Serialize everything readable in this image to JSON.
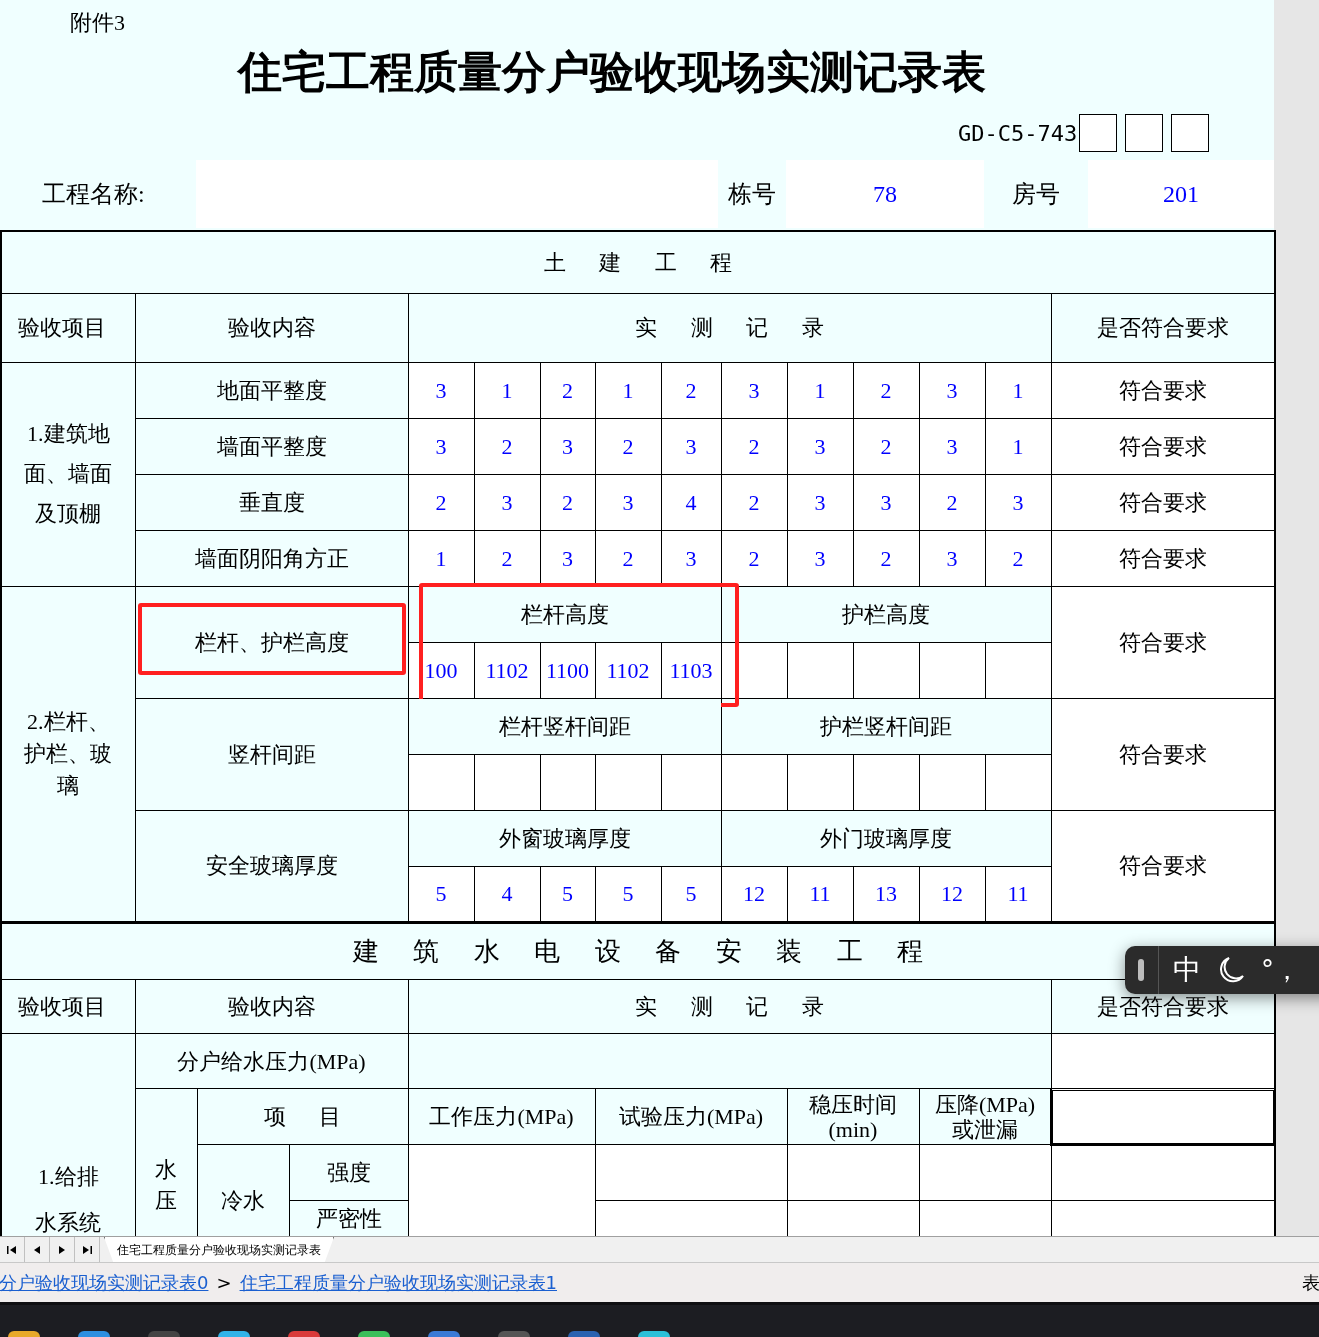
{
  "header": {
    "attachment": "附件3",
    "title": "住宅工程质量分户验收现场实测记录表",
    "code": "GD-C5-743"
  },
  "project": {
    "name_label": "工程名称:",
    "building_label": "栋号",
    "building": "78",
    "room_label": "房号",
    "room": "201"
  },
  "civil": {
    "title": "土 建 工 程",
    "headers": [
      "验收项目",
      "验收内容",
      "实 测 记 录",
      "是否符合要求"
    ],
    "group1": {
      "item": "1.建筑地面、墙面及顶棚",
      "rows": [
        {
          "content": "地面平整度",
          "values": [
            "3",
            "1",
            "2",
            "1",
            "2",
            "3",
            "1",
            "2",
            "3",
            "1"
          ],
          "result": "符合要求"
        },
        {
          "content": "墙面平整度",
          "values": [
            "3",
            "2",
            "3",
            "2",
            "3",
            "2",
            "3",
            "2",
            "3",
            "1"
          ],
          "result": "符合要求"
        },
        {
          "content": "垂直度",
          "values": [
            "2",
            "3",
            "2",
            "3",
            "4",
            "2",
            "3",
            "3",
            "2",
            "3"
          ],
          "result": "符合要求"
        },
        {
          "content": "墙面阴阳角方正",
          "values": [
            "1",
            "2",
            "3",
            "2",
            "3",
            "2",
            "3",
            "2",
            "3",
            "2"
          ],
          "result": "符合要求"
        }
      ]
    },
    "group2": {
      "item": "2.栏杆、护栏、玻璃",
      "rows": [
        {
          "content": "栏杆、护栏高度",
          "highlighted": true,
          "left_label": "栏杆高度",
          "left_highlighted": true,
          "left_values": [
            "100",
            "1102",
            "1100",
            "1102",
            "1103"
          ],
          "right_label": "护栏高度",
          "right_values": [],
          "result": "符合要求"
        },
        {
          "content": "竖杆间距",
          "highlighted": false,
          "left_label": "栏杆竖杆间距",
          "left_highlighted": false,
          "left_values": [],
          "right_label": "护栏竖杆间距",
          "right_values": [],
          "result": "符合要求"
        },
        {
          "content": "安全玻璃厚度",
          "highlighted": false,
          "left_label": "外窗玻璃厚度",
          "left_highlighted": false,
          "left_values": [
            "5",
            "4",
            "5",
            "5",
            "5"
          ],
          "right_label": "外门玻璃厚度",
          "right_values": [
            "12",
            "11",
            "13",
            "12",
            "11"
          ],
          "result": "符合要求"
        }
      ]
    }
  },
  "install": {
    "title": "建 筑 水 电 设 备 安 装 工 程",
    "headers": [
      "验收项目",
      "验收内容",
      "实 测 记 录",
      "是否符合要求"
    ],
    "pressure_label": "分户给水压力(MPa)",
    "item": "1.给排水系统",
    "test": "水压",
    "items_header": "项 目",
    "columns": [
      "工作压力(MPa)",
      "试验压力(MPa)",
      "稳压时间(min)",
      "压降(MPa)或泄漏"
    ],
    "result_selected": true,
    "water": "冷水",
    "checks": [
      "强度",
      "严密性"
    ]
  },
  "ime": {
    "mode": "中",
    "punctuation": "°，"
  },
  "sheet_tabs": [
    {
      "label": "住宅工程质量分户验收现场实测记录表",
      "selected": true
    }
  ],
  "breadcrumb": {
    "items": [
      "分户验收现场实测记录表0",
      "住宅工程质量分户验收现场实测记录表1"
    ],
    "separator": ">",
    "right": "表"
  }
}
